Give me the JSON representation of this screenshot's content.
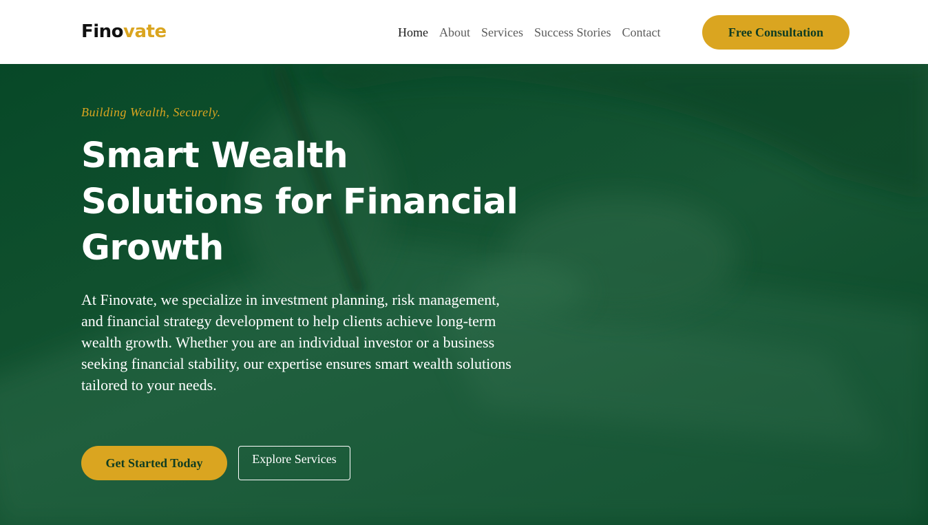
{
  "header": {
    "logo_part1": "Fino",
    "logo_part2": "vate",
    "nav": [
      {
        "label": "Home",
        "active": true
      },
      {
        "label": "About",
        "active": false
      },
      {
        "label": "Services",
        "active": false
      },
      {
        "label": "Success Stories",
        "active": false
      },
      {
        "label": "Contact",
        "active": false
      }
    ],
    "cta_label": "Free Consultation"
  },
  "hero": {
    "tagline": "Building Wealth, Securely.",
    "title": "Smart Wealth Solutions for Financial Growth",
    "description": "At Finovate, we specialize in investment planning, risk management, and financial strategy development to help clients achieve long-term wealth growth. Whether you are an individual investor or a business seeking financial stability, our expertise ensures smart wealth solutions tailored to your needs.",
    "primary_button": "Get Started Today",
    "secondary_button": "Explore Services",
    "background_image": "person-signing-document-photo"
  },
  "colors": {
    "accent": "#daa520",
    "hero_green": "#0f4d2c",
    "button_text": "#0e3c22",
    "nav_text": "#5b5b5b"
  }
}
